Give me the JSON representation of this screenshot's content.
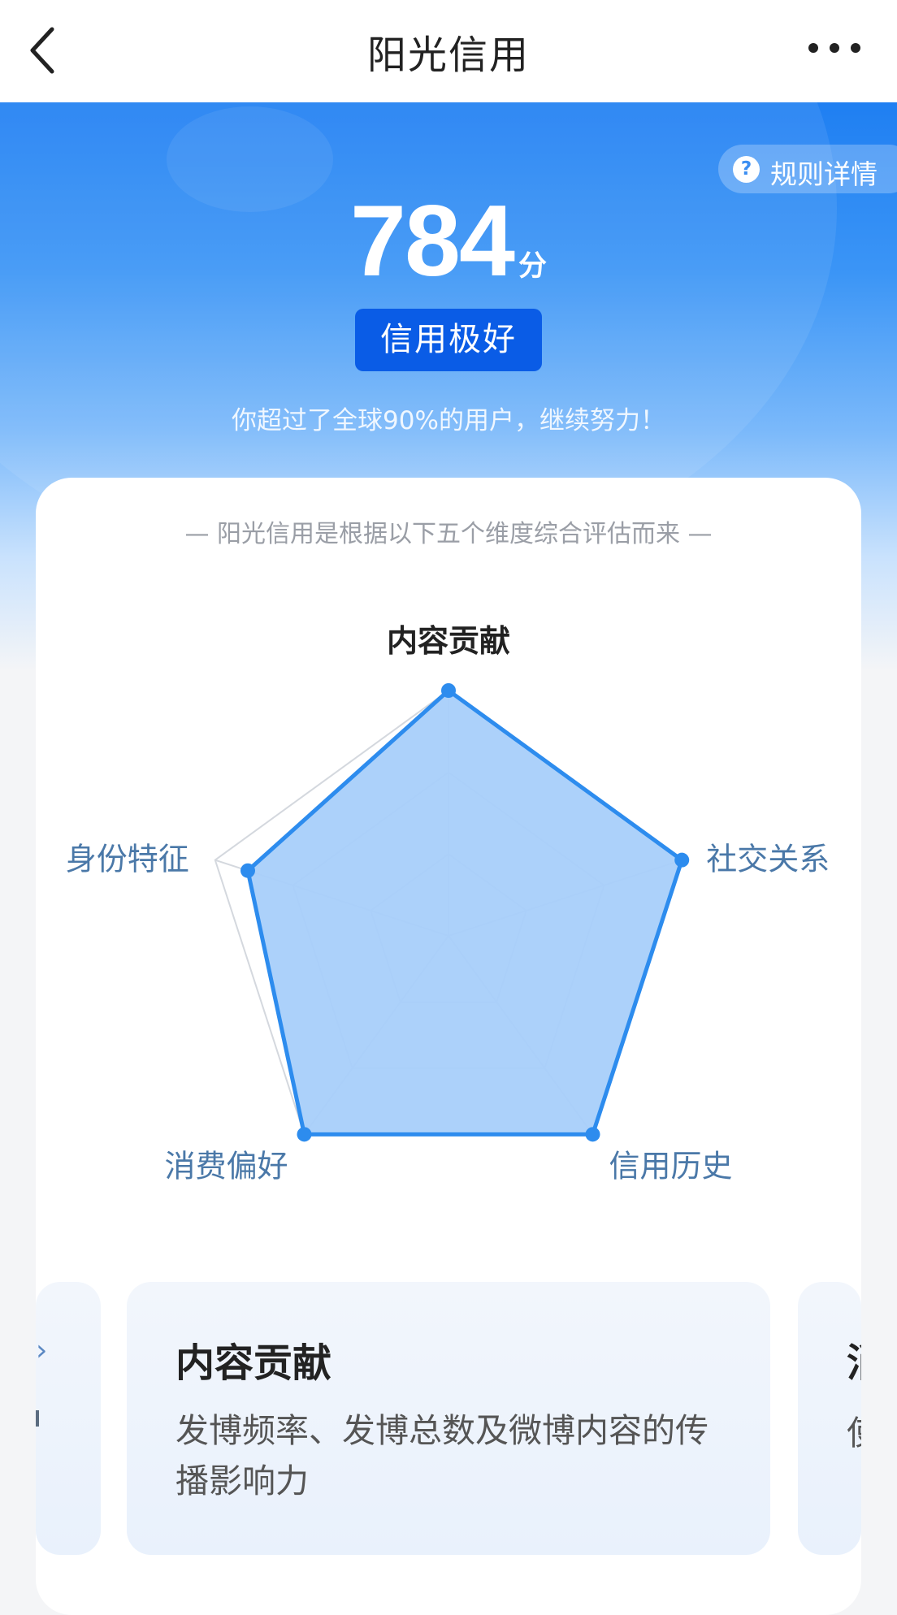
{
  "header": {
    "title": "阳光信用"
  },
  "hero": {
    "rules_label": "规则详情",
    "score": "784",
    "score_unit": "分",
    "level": "信用极好",
    "rank_text": "你超过了全球90%的用户，继续努力！"
  },
  "radar": {
    "intro": "— 阳光信用是根据以下五个维度综合评估而来 —",
    "dimensions": [
      {
        "label": "内容贡献",
        "value": 1.0
      },
      {
        "label": "社交关系",
        "value": 1.0
      },
      {
        "label": "信用历史",
        "value": 1.0
      },
      {
        "label": "消费偏好",
        "value": 1.0
      },
      {
        "label": "身份特征",
        "value": 0.86
      }
    ],
    "colors": {
      "fill": "#a8cffa",
      "stroke": "#2d8cee",
      "grid": "#d4d8de"
    }
  },
  "dimension_cards": {
    "current": {
      "title": "内容贡献",
      "desc": "发博频率、发博总数及微博内容的传播影响力"
    },
    "next": {
      "title": "消",
      "desc": "使"
    }
  }
}
